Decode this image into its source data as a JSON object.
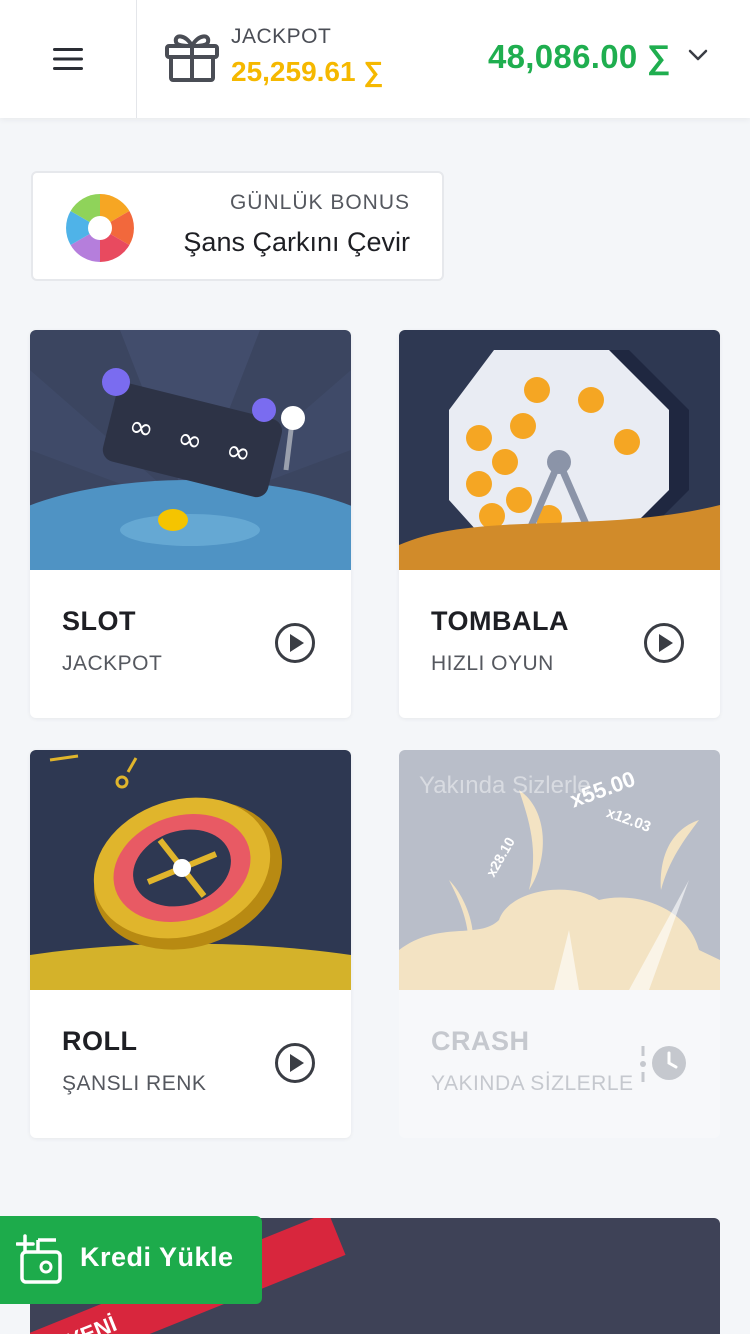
{
  "header": {
    "menu_icon": "hamburger-menu-icon",
    "jackpot_icon": "gift-icon",
    "jackpot_label": "JACKPOT",
    "jackpot_value": "25,259.61 ∑",
    "balance": "48,086.00 ∑",
    "balance_chevron_icon": "chevron-down-icon",
    "colors": {
      "balance": "#1fae4f",
      "jackpot": "#f5b800"
    }
  },
  "bonus": {
    "icon": "color-wheel-icon",
    "label": "GÜNLÜK BONUS",
    "title": "Şans Çarkını Çevir"
  },
  "games": [
    {
      "title": "SLOT",
      "subtitle": "JACKPOT",
      "action_icon": "play-icon",
      "enabled": true
    },
    {
      "title": "TOMBALA",
      "subtitle": "HIZLI OYUN",
      "action_icon": "play-icon",
      "enabled": true
    },
    {
      "title": "ROLL",
      "subtitle": "ŞANSLI RENK",
      "action_icon": "play-icon",
      "enabled": true
    },
    {
      "title": "CRASH",
      "subtitle": "YAKINDA SİZLERLE",
      "action_icon": "clock-icon",
      "enabled": false,
      "overlay_text": "Yakında Sizlerle",
      "multipliers": [
        "x55.00",
        "x12.03",
        "x28.10"
      ]
    }
  ],
  "promo": {
    "ribbon_text": "YENİ"
  },
  "kredi_button": {
    "icon": "wallet-add-icon",
    "label": "Kredi Yükle",
    "color": "#1dab4b"
  }
}
